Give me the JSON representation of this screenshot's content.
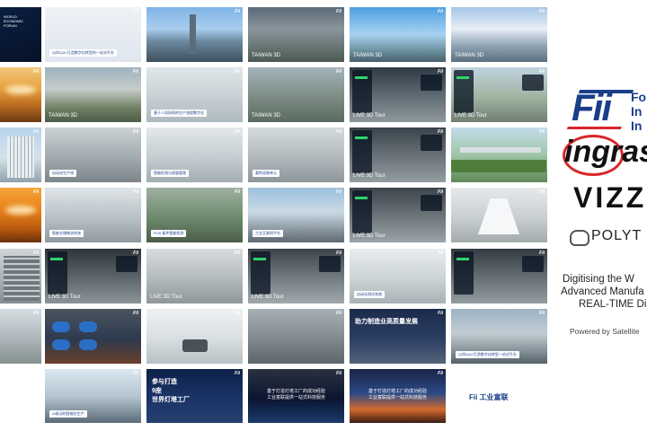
{
  "tiles": [
    {
      "bg": "linear-gradient(160deg,#0b1e3f,#06122a)",
      "dark": true,
      "logo": "WORLD\nECONOMIC\nFORUM"
    },
    {
      "bg": "linear-gradient(180deg,#eef2f6,#dfe6ee)",
      "pill": "以伴以AI 打造数字化转型的一站式平台"
    },
    {
      "bg": "linear-gradient(180deg,#7fb4e6 0%,#a9cdee 40%,#6d8aa1 62%,#3d4f5e 100%)",
      "tower": true
    },
    {
      "bg": "linear-gradient(180deg,#5a6a78,#8a959c 40%,#4c5a52)",
      "cap": "TAIWAN 3D"
    },
    {
      "bg": "linear-gradient(180deg,#4f9fe0,#a8d2f2 50%,#6b8f9e 80%,#48616b)",
      "cap": "TAIWAN 3D"
    },
    {
      "bg": "linear-gradient(180deg,#a7c5e8,#e8eef5 40%,#8fa4b5 70%,#5c6f7e)",
      "cap": "TAIWAN 3D"
    },
    {
      "bg": "linear-gradient(180deg,#f2c77a,#e6a03c 40%,#b86a1e 70%,#6b3b12)",
      "sun": true
    },
    {
      "bg": "linear-gradient(180deg,#9fb2bf,#c5ccc8 40%,#6d7f63 75%,#4d5c48)",
      "cap": "TAIWAN 3D"
    },
    {
      "bg": "linear-gradient(180deg,#dfe6ea,#c9d2d6 50%,#aeb9be)",
      "pill": "基于人机协同的生产流程数字化"
    },
    {
      "bg": "linear-gradient(180deg,#a3b4bc,#7f8f88 50%,#5a6b61)",
      "cap": "TAIWAN 3D"
    },
    {
      "bg": "linear-gradient(180deg,#2f3a44,#5d6a72 50%,#8e989c)",
      "cap": "LIVE 3D Tour",
      "hud": true
    },
    {
      "bg": "linear-gradient(180deg,#c0d3e0,#9fb3a0 55%,#6f7e71)",
      "cap": "LIVE 3D Tour",
      "hud": true
    },
    {
      "bg": "linear-gradient(180deg,#b7d3ec,#d6e2ea 55%,#93a2ac)",
      "building": true
    },
    {
      "bg": "linear-gradient(180deg,#ccd3d7,#a1aaae 55%,#7c858a)",
      "pill": "自动化生产线"
    },
    {
      "bg": "linear-gradient(180deg,#e3e8eb,#c4cdd1 55%,#a2adb2)",
      "pill": "智能检测与质量管理"
    },
    {
      "bg": "linear-gradient(180deg,#d4dadd,#b1b9bd 55%,#8e979c)",
      "pill": "柔性组装单元"
    },
    {
      "bg": "linear-gradient(180deg,#3a434b,#6b757b 55%,#949da2)",
      "cap": "LIVE 3D Tour",
      "hud": true
    },
    {
      "bg": "linear-gradient(180deg,#c3dcec,#9fc5a8 50%,#5f8a56)",
      "bridge": true
    },
    {
      "bg": "linear-gradient(180deg,#f4a63a,#e88217 40%,#b95a10 75%,#6a2f08)",
      "sun": true
    },
    {
      "bg": "linear-gradient(180deg,#dfe4e8,#b8c1c6 55%,#8f999e)",
      "pill": "智能仓储物流系统"
    },
    {
      "bg": "linear-gradient(180deg,#9fb0a0,#6e8a6e 55%,#495e48)",
      "pill": "PCB 板件智能检测"
    },
    {
      "bg": "linear-gradient(180deg,#9dc1de,#c9d9e4 45%,#8d9aa3 75%,#5d6a72)",
      "pill": "工业互联网平台"
    },
    {
      "bg": "linear-gradient(180deg,#3c454c,#6e787d 55%,#9aa3a8)",
      "cap": "LIVE 3D Tour",
      "hud": true
    },
    {
      "bg": "linear-gradient(180deg,#e6e9eb,#c8ced1 55%,#a3abaf)",
      "corridor": true
    },
    {
      "bg": "linear-gradient(180deg,#cfd5d8,#aab2b6 55%,#858e93)",
      "server": true
    },
    {
      "bg": "linear-gradient(180deg,#2d353b,#5e686d 55%,#8b9499)",
      "cap": "LIVE 3D Tour",
      "hud": true
    },
    {
      "bg": "linear-gradient(180deg,#d7dcdf,#b3babe 55%,#8f979b)",
      "cap": "LIVE 3D Tour"
    },
    {
      "bg": "linear-gradient(180deg,#3b444a,#737d82 55%,#a0a8ac)",
      "cap": "LIVE 3D Tour",
      "hud": true
    },
    {
      "bg": "linear-gradient(180deg,#e8ecee,#ccd3d6 55%,#a9b2b6)",
      "pill": "自动化测试系统"
    },
    {
      "bg": "linear-gradient(180deg,#333c42,#677176 55%,#949da1)",
      "cap": "",
      "hud": true
    },
    {
      "bg": "linear-gradient(180deg,#d6dde1,#b0b9bd 50%,#85908f)",
      "cap": ""
    },
    {
      "bg": "linear-gradient(180deg,#4b5560,#2d3a4f 55%,#6b3f2a)",
      "stats": true
    },
    {
      "bg": "linear-gradient(180deg,#eef1f3,#d8dee1 55%,#b8c0c4)",
      "robot": true
    },
    {
      "bg": "linear-gradient(180deg,#a7b0b5,#7f898e 55%,#5c656a)",
      "cap": ""
    },
    {
      "bg": "linear-gradient(180deg,#1b2a4a,#2c3f63 55%,#56637a)",
      "title": "助力制造业高质量发展"
    },
    {
      "bg": "linear-gradient(180deg,#9db3c4,#c3ccd2 45%,#7d8b92 80%,#55616a)",
      "pill": "以伴以AI 打造数字化转型一站式平台"
    },
    {
      "bg": "linear-gradient(180deg,#ffffff,#f3f5f7)",
      "empty": true
    },
    {
      "bg": "linear-gradient(180deg,#dbe6ee,#b5c6d2 50%,#5c6d79)",
      "pill": "AI驱动的智能化生产"
    },
    {
      "bg": "linear-gradient(180deg,#0d2147,#1b3468 55%,#27406f)",
      "title": "参与打造\n9座\n世界灯塔工厂"
    },
    {
      "bg": "linear-gradient(180deg,#2a3240,#0c1530 55%,#1b3a6c)",
      "banner": "基于打造灯塔工厂的成功经验\n工业富联提供一站式科技服务",
      "pillbar": true
    },
    {
      "bg": "linear-gradient(180deg,#1a2447,#2b4a86 45%,#d26a2d 75%,#3b1e12)",
      "banner": "基于打造灯塔工厂的成功经验\n工业富联提供一站式科技服务",
      "pillbar": true
    },
    {
      "bg": "#ffffff",
      "logotile": "Fii 工业富联"
    }
  ],
  "brand": {
    "fii_mark": "Fii",
    "fii_side": [
      "Fo",
      "In",
      "In"
    ],
    "ingrasys": "ingras",
    "vizz": "VIZZ",
    "polyt": "POLYT",
    "tagline": [
      "Digitising the W",
      "Advanced Manufa",
      "REAL-TIME Di"
    ],
    "powered": "Powered by Satellite"
  },
  "colors": {
    "fii_blue": "#1a3f8a",
    "ingrasys_red": "#d9262c"
  }
}
